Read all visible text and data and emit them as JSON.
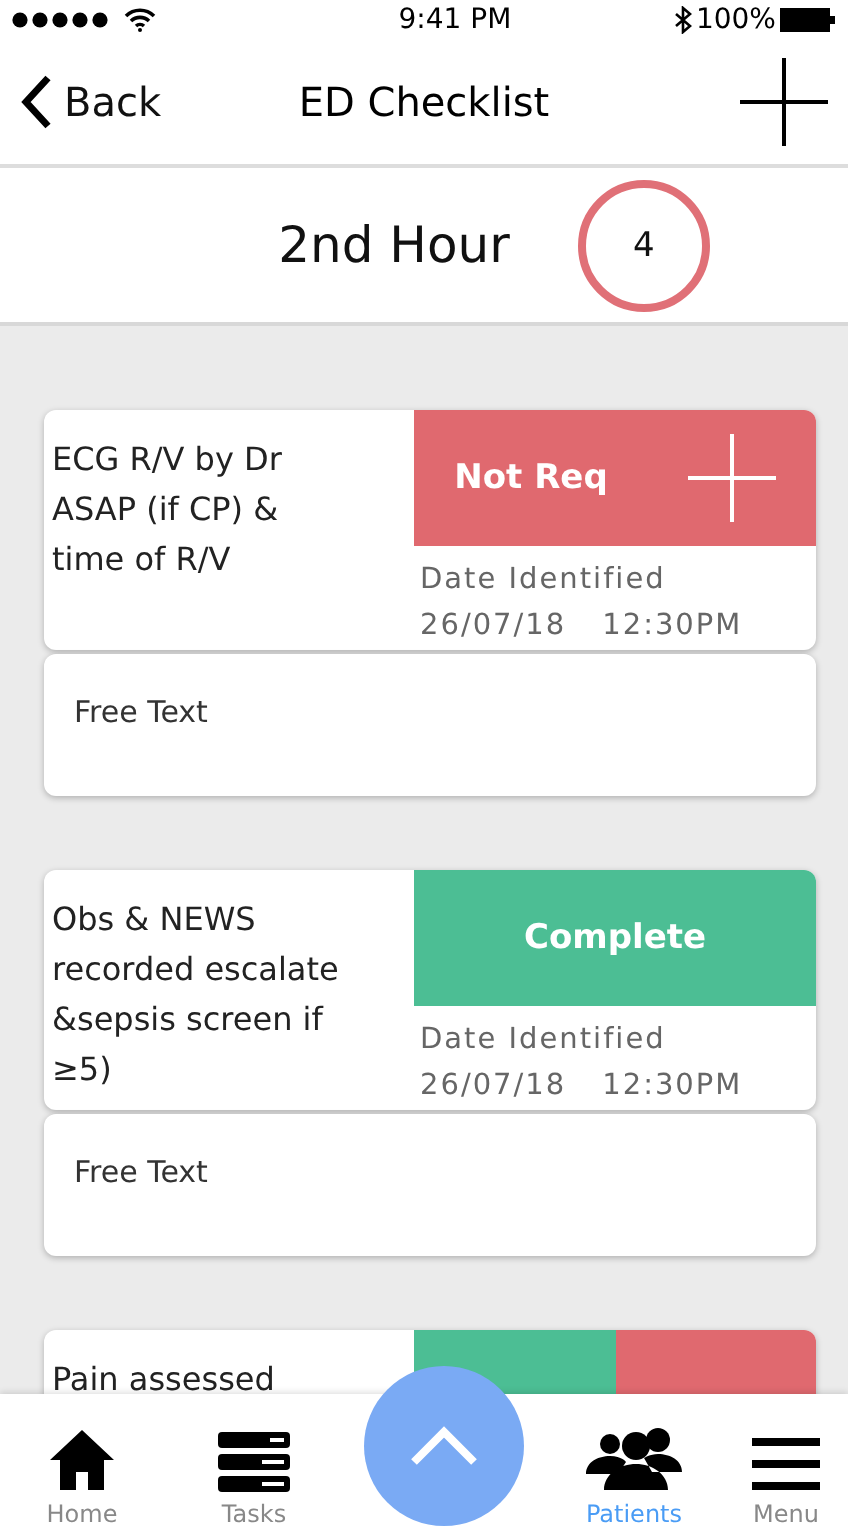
{
  "status_bar": {
    "time": "9:41 PM",
    "battery": "100%"
  },
  "nav": {
    "back": "Back",
    "title": "ED Checklist"
  },
  "header": {
    "title": "2nd Hour",
    "count": "4"
  },
  "cards": [
    {
      "task": "ECG R/V by Dr ASAP (if CP) & time of R/V",
      "segments": [
        {
          "kind": "not_required",
          "label": "Not Req",
          "add": true
        }
      ],
      "date_label": "Date Identified",
      "date": "26/07/18",
      "time": "12:30PM",
      "note": {
        "placeholder": "Free Text"
      }
    },
    {
      "task": "Obs & NEWS recorded escalate &sepsis screen if ≥5)",
      "segments": [
        {
          "kind": "complete",
          "label": "Complete",
          "add": false
        }
      ],
      "date_label": "Date Identified",
      "date": "26/07/18",
      "time": "12:30PM",
      "note": {
        "placeholder": "Free Text"
      }
    },
    {
      "task": "Pain assessed",
      "segments": [
        {
          "kind": "complete",
          "add": false
        },
        {
          "kind": "not_required",
          "add": false
        }
      ]
    }
  ],
  "tabs": [
    {
      "kind": "home",
      "label": "Home",
      "selected": false
    },
    {
      "kind": "tasks",
      "label": "Tasks",
      "selected": false
    },
    {
      "kind": "patients",
      "label": "Patients",
      "selected": true
    },
    {
      "kind": "menu",
      "label": "Menu",
      "selected": false
    }
  ]
}
